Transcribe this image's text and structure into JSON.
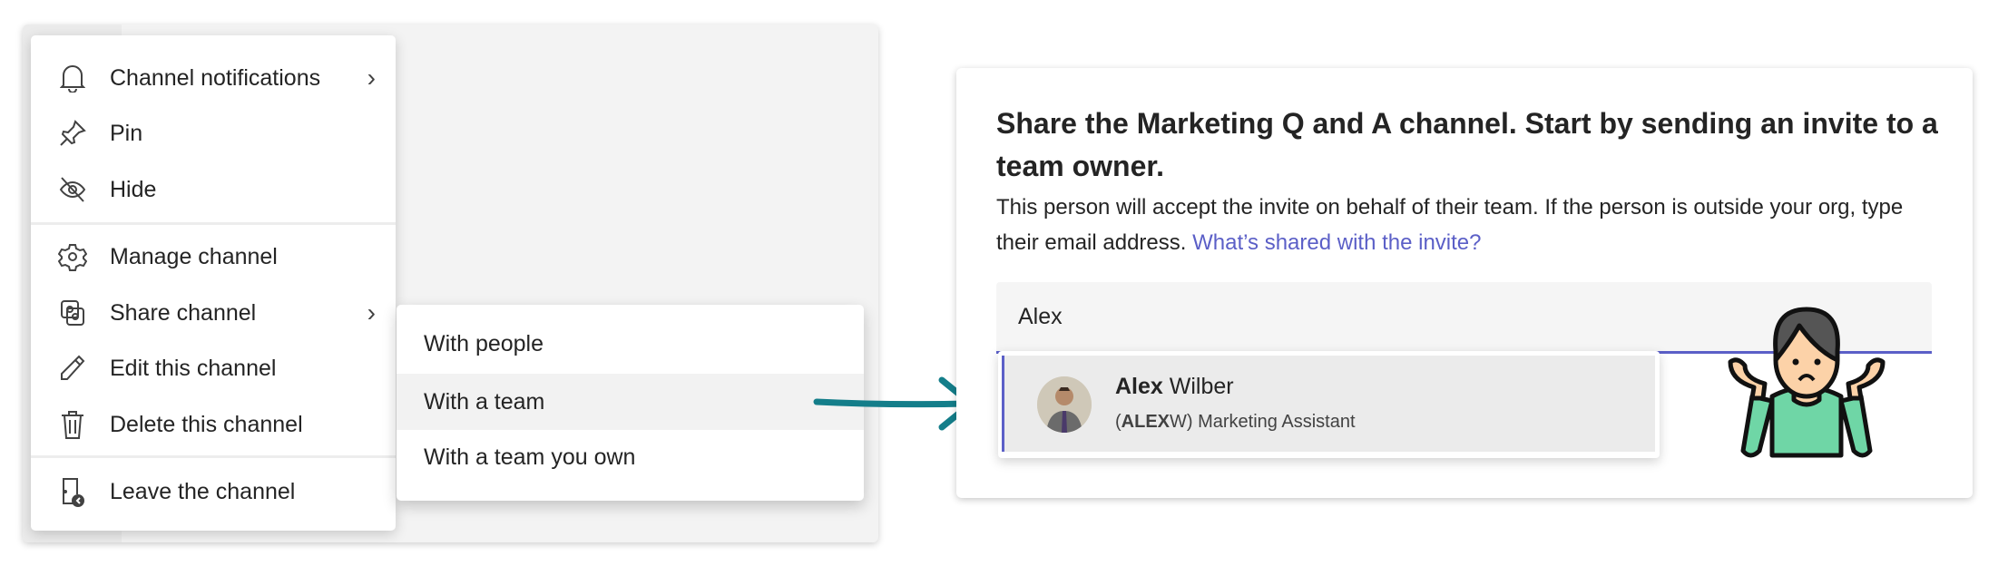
{
  "context_menu": {
    "items": [
      {
        "label": "Channel notifications",
        "icon": "bell-icon",
        "submenu": true
      },
      {
        "label": "Pin",
        "icon": "pin-icon"
      },
      {
        "label": "Hide",
        "icon": "eye-off-icon"
      },
      {
        "label": "Manage channel",
        "icon": "gear-icon"
      },
      {
        "label": "Share channel",
        "icon": "share-icon",
        "submenu": true
      },
      {
        "label": "Edit this channel",
        "icon": "pencil-icon"
      },
      {
        "label": "Delete this channel",
        "icon": "trash-icon"
      },
      {
        "label": "Leave the channel",
        "icon": "leave-icon"
      }
    ]
  },
  "share_submenu": {
    "items": [
      {
        "label": "With people"
      },
      {
        "label": "With a team",
        "highlighted": true
      },
      {
        "label": "With a team you own"
      }
    ]
  },
  "arrow_color": "#147e8a",
  "dialog": {
    "title": "Share the Marketing Q and A channel. Start by sending an invite to a team owner.",
    "description": "This person will accept the invite on behalf of their team. If the person is outside your org, type their email address.",
    "link": "What’s shared with the invite?",
    "input_value": "Alex",
    "suggestion": {
      "first": "Alex",
      "last": " Wilber",
      "alias_open": "(",
      "alias_bold": "ALEX",
      "alias_rest": "W) Marketing Assistant"
    },
    "accent": "#5b5fc7"
  }
}
